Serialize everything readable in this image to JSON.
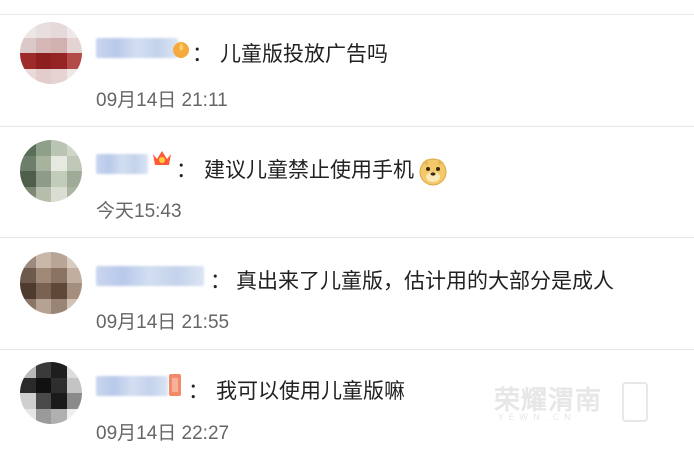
{
  "comments": [
    {
      "text": "儿童版投放广告吗",
      "time": "09月14日 21:11",
      "badge": "flame-badge-icon",
      "emoji": null
    },
    {
      "text": "建议儿童禁止使用手机",
      "time": "今天15:43",
      "badge": "crown-badge-icon",
      "emoji": "doge-emoji-icon"
    },
    {
      "text": "真出来了儿童版，估计用的大部分是成人",
      "time": "09月14日 21:55",
      "badge": null,
      "emoji": null
    },
    {
      "text": "我可以使用儿童版嘛",
      "time": "09月14日 22:27",
      "badge": "orange-tag-icon",
      "emoji": null
    }
  ],
  "separator": "：",
  "watermark": {
    "main": "荣耀渭南",
    "sub": "YEWN.CN"
  },
  "colors": {
    "text": "#222222",
    "time": "#666666",
    "divider": "#e6e6e6",
    "name_blur": "#c9d6ee"
  }
}
